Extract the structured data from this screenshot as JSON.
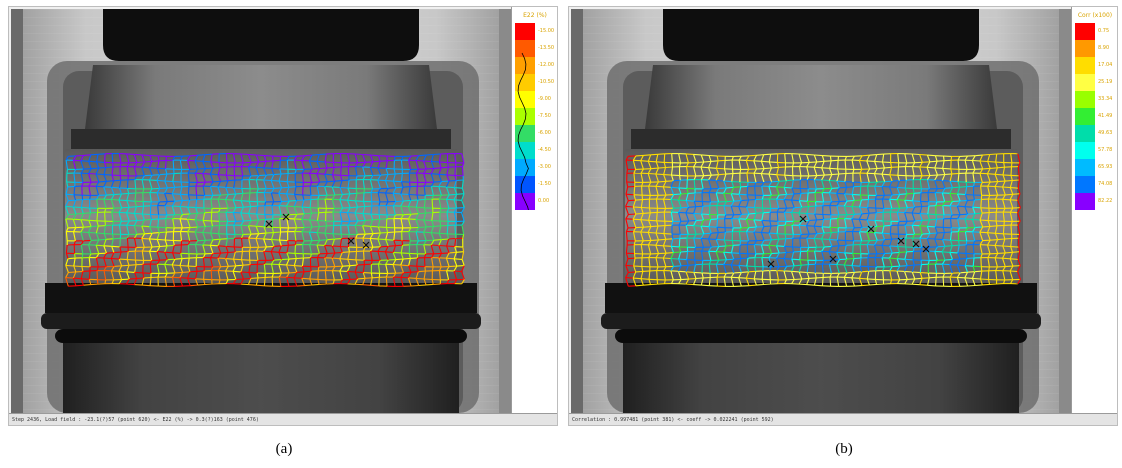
{
  "panels": [
    {
      "id": "a",
      "caption": "(a)",
      "status": "Step 2436, Load field : -23.1(?)57 (point 620) <- E22 (%) -> 0.3(?)163 (point 476)",
      "colorbar": {
        "title": "E22 (%)",
        "labels": [
          "-15.00",
          "-13.50",
          "-12.00",
          "-10.50",
          "-9.00",
          "-7.50",
          "-6.00",
          "-4.50",
          "-3.00",
          "-1.50",
          "0.00"
        ],
        "colors": [
          "#ff0000",
          "#ff5a00",
          "#ffa000",
          "#ffcc00",
          "#ffff00",
          "#aaff00",
          "#33dd66",
          "#00ddcc",
          "#00aaff",
          "#0055ff",
          "#8800ff"
        ]
      }
    },
    {
      "id": "b",
      "caption": "(b)",
      "status": "Correlation : 0.997481 (point 381) <- coeff -> 0.022241 (point 592)",
      "colorbar": {
        "title": "Corr (x100)",
        "labels": [
          "0.75",
          "8.90",
          "17.04",
          "25.19",
          "33.34",
          "41.49",
          "49.63",
          "57.78",
          "65.93",
          "74.08",
          "82.22"
        ],
        "colors": [
          "#ff0000",
          "#ff9900",
          "#ffdd00",
          "#ffff44",
          "#99ff00",
          "#33ee33",
          "#00ddaa",
          "#00ffee",
          "#00bbff",
          "#0077ff",
          "#8800ff"
        ]
      }
    }
  ],
  "icons": {
    "specimen_a": "xray-specimen-image",
    "specimen_b": "xray-specimen-image"
  }
}
